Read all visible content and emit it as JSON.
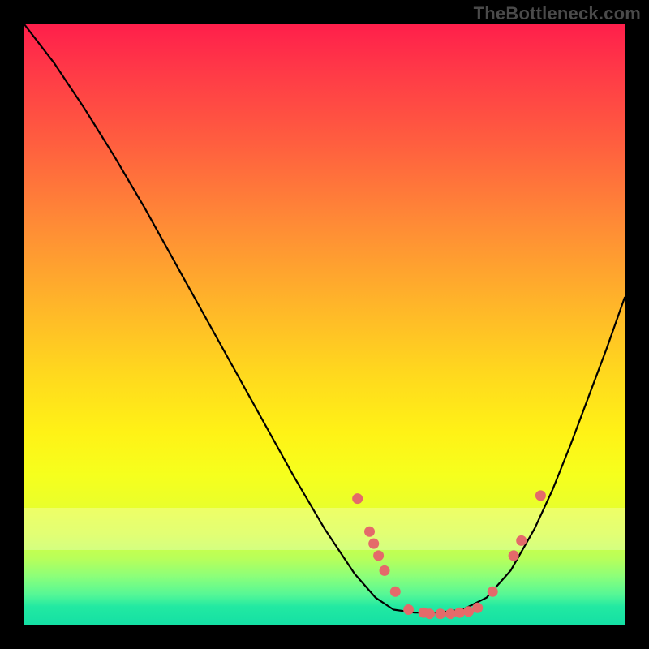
{
  "watermark": "TheBottleneck.com",
  "chart_data": {
    "type": "line",
    "title": "",
    "xlabel": "",
    "ylabel": "",
    "xlim": [
      0,
      1
    ],
    "ylim": [
      0,
      1
    ],
    "curve": [
      {
        "x": 0.0,
        "y": 1.0
      },
      {
        "x": 0.05,
        "y": 0.935
      },
      {
        "x": 0.1,
        "y": 0.86
      },
      {
        "x": 0.15,
        "y": 0.78
      },
      {
        "x": 0.2,
        "y": 0.695
      },
      {
        "x": 0.25,
        "y": 0.605
      },
      {
        "x": 0.3,
        "y": 0.515
      },
      {
        "x": 0.35,
        "y": 0.425
      },
      {
        "x": 0.4,
        "y": 0.335
      },
      {
        "x": 0.45,
        "y": 0.245
      },
      {
        "x": 0.5,
        "y": 0.16
      },
      {
        "x": 0.55,
        "y": 0.085
      },
      {
        "x": 0.585,
        "y": 0.045
      },
      {
        "x": 0.615,
        "y": 0.025
      },
      {
        "x": 0.65,
        "y": 0.02
      },
      {
        "x": 0.69,
        "y": 0.02
      },
      {
        "x": 0.73,
        "y": 0.025
      },
      {
        "x": 0.77,
        "y": 0.045
      },
      {
        "x": 0.81,
        "y": 0.09
      },
      {
        "x": 0.85,
        "y": 0.16
      },
      {
        "x": 0.88,
        "y": 0.225
      },
      {
        "x": 0.91,
        "y": 0.3
      },
      {
        "x": 0.94,
        "y": 0.38
      },
      {
        "x": 0.97,
        "y": 0.46
      },
      {
        "x": 1.0,
        "y": 0.545
      }
    ],
    "markers": [
      {
        "x": 0.555,
        "y": 0.21
      },
      {
        "x": 0.575,
        "y": 0.155
      },
      {
        "x": 0.582,
        "y": 0.135
      },
      {
        "x": 0.59,
        "y": 0.115
      },
      {
        "x": 0.6,
        "y": 0.09
      },
      {
        "x": 0.618,
        "y": 0.055
      },
      {
        "x": 0.64,
        "y": 0.025
      },
      {
        "x": 0.665,
        "y": 0.02
      },
      {
        "x": 0.675,
        "y": 0.018
      },
      {
        "x": 0.693,
        "y": 0.018
      },
      {
        "x": 0.71,
        "y": 0.018
      },
      {
        "x": 0.725,
        "y": 0.02
      },
      {
        "x": 0.74,
        "y": 0.022
      },
      {
        "x": 0.755,
        "y": 0.028
      },
      {
        "x": 0.78,
        "y": 0.055
      },
      {
        "x": 0.815,
        "y": 0.115
      },
      {
        "x": 0.828,
        "y": 0.14
      },
      {
        "x": 0.86,
        "y": 0.215
      }
    ],
    "colors": {
      "curve_line": "#000000",
      "marker_fill": "#e46a6a",
      "gradient_top": "#ff1f4b",
      "gradient_bottom": "#14e0a4"
    }
  }
}
